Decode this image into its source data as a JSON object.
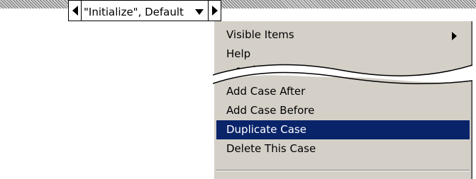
{
  "case_selector": {
    "value": "\"Initialize\", Default"
  },
  "context_menu": {
    "items": [
      {
        "label": "Visible Items",
        "has_submenu": true
      },
      {
        "label": "Help"
      },
      {
        "label": "Add Case After"
      },
      {
        "label": "Add Case Before"
      },
      {
        "label": "Duplicate Case",
        "selected": true
      },
      {
        "label": "Delete This Case"
      }
    ],
    "partial_label": "...and Tip..."
  },
  "colors": {
    "menu_background": "#d4d0c8",
    "selection_background": "#0a246a",
    "selection_text": "#ffffff"
  }
}
